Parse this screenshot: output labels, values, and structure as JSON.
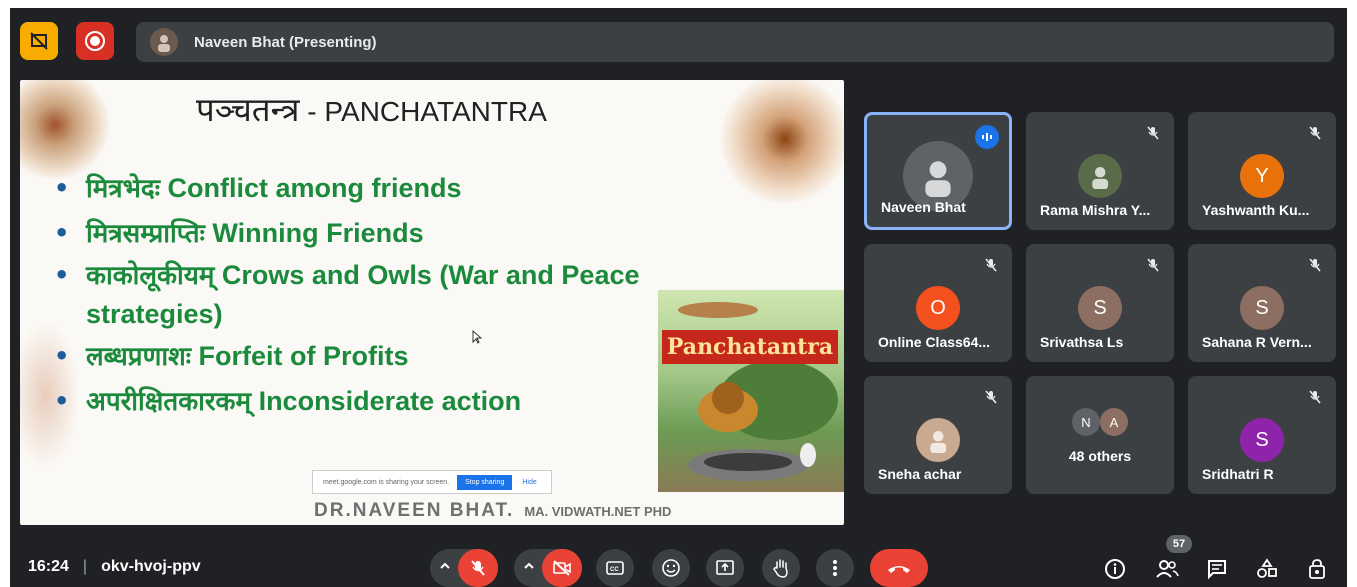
{
  "topbar": {
    "presenter_label": "Naveen Bhat (Presenting)",
    "icons": [
      "present-layout-icon",
      "record-icon"
    ]
  },
  "slide": {
    "title_sanskrit": "पञ्चतन्त्र",
    "title_latin": " - PANCHATANTRA",
    "bullets": [
      {
        "sanskrit": "मित्रभेदः",
        "english": " Conflict among friends"
      },
      {
        "sanskrit": "मित्रसम्प्राप्तिः",
        "english": " Winning Friends"
      },
      {
        "sanskrit": "काकोलूकीयम्",
        "english": "  Crows and Owls (War and Peace strategies)"
      },
      {
        "sanskrit": "लब्धप्रणाशः",
        "english": " Forfeit of Profits"
      },
      {
        "sanskrit": "अपरीक्षितकारकम्",
        "english": "  Inconsiderate action"
      }
    ],
    "book_title": "Panchatantra",
    "sharebar": {
      "text": "meet.google.com is sharing your screen.",
      "stop_label": "Stop sharing",
      "hide_label": "Hide"
    },
    "signature": "DR.NAVEEN BHAT.",
    "signature_sub": "MA. VIDWATH.NET PHD"
  },
  "participants": [
    {
      "name": "Naveen Bhat",
      "initial": "",
      "color": "#5f6368",
      "speaking": true,
      "muted": false
    },
    {
      "name": "Rama Mishra Y...",
      "initial": "",
      "color": "#5a6b4a",
      "speaking": false,
      "muted": true
    },
    {
      "name": "Yashwanth Ku...",
      "initial": "Y",
      "color": "#e8710a",
      "speaking": false,
      "muted": true
    },
    {
      "name": "Online Class64...",
      "initial": "O",
      "color": "#f4511e",
      "speaking": false,
      "muted": true
    },
    {
      "name": "Srivathsa Ls",
      "initial": "S",
      "color": "#8d6e63",
      "speaking": false,
      "muted": true
    },
    {
      "name": "Sahana R Vern...",
      "initial": "S",
      "color": "#8d6e63",
      "speaking": false,
      "muted": true
    },
    {
      "name": "Sneha achar",
      "initial": "",
      "color": "#c9a98f",
      "speaking": false,
      "muted": true
    },
    {
      "name": "48 others",
      "initial": "",
      "color": "",
      "speaking": false,
      "muted": false
    },
    {
      "name": "Sridhatri R",
      "initial": "S",
      "color": "#8e24aa",
      "speaking": false,
      "muted": true
    }
  ],
  "others": {
    "a": "N",
    "b": "A",
    "a_color": "#5f6368",
    "b_color": "#8d6e63"
  },
  "bottombar": {
    "time": "16:24",
    "meeting_code": "okv-hvoj-ppv",
    "people_count": "57"
  }
}
